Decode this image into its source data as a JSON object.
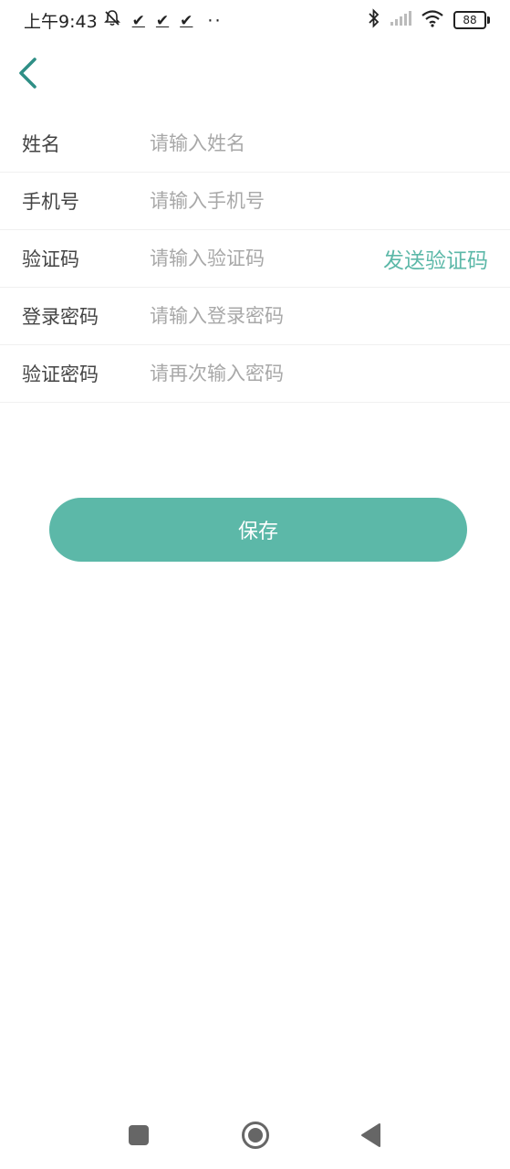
{
  "status_bar": {
    "time": "上午9:43",
    "notification_checks": [
      "✔",
      "✔",
      "✔"
    ],
    "more_dots": "··",
    "battery_level": "88"
  },
  "form": {
    "fields": [
      {
        "key": "name",
        "label": "姓名",
        "placeholder": "请输入姓名",
        "value": ""
      },
      {
        "key": "phone",
        "label": "手机号",
        "placeholder": "请输入手机号",
        "value": ""
      },
      {
        "key": "code",
        "label": "验证码",
        "placeholder": "请输入验证码",
        "value": ""
      },
      {
        "key": "password",
        "label": "登录密码",
        "placeholder": "请输入登录密码",
        "value": ""
      },
      {
        "key": "confirm",
        "label": "验证密码",
        "placeholder": "请再次输入密码",
        "value": ""
      }
    ],
    "send_code_label": "发送验证码"
  },
  "actions": {
    "save_label": "保存"
  },
  "colors": {
    "accent": "#5cb8a8",
    "back_icon": "#2f8f86",
    "placeholder": "#a8a8a8",
    "label": "#444444",
    "divider": "#f0f0f0"
  },
  "icons": {
    "back": "chevron-left-icon",
    "mute": "bell-off-icon",
    "bluetooth": "bluetooth-icon",
    "signal": "signal-icon",
    "wifi": "wifi-icon",
    "battery": "battery-icon",
    "nav_recent": "square-icon",
    "nav_home": "circle-icon",
    "nav_back": "triangle-back-icon"
  }
}
